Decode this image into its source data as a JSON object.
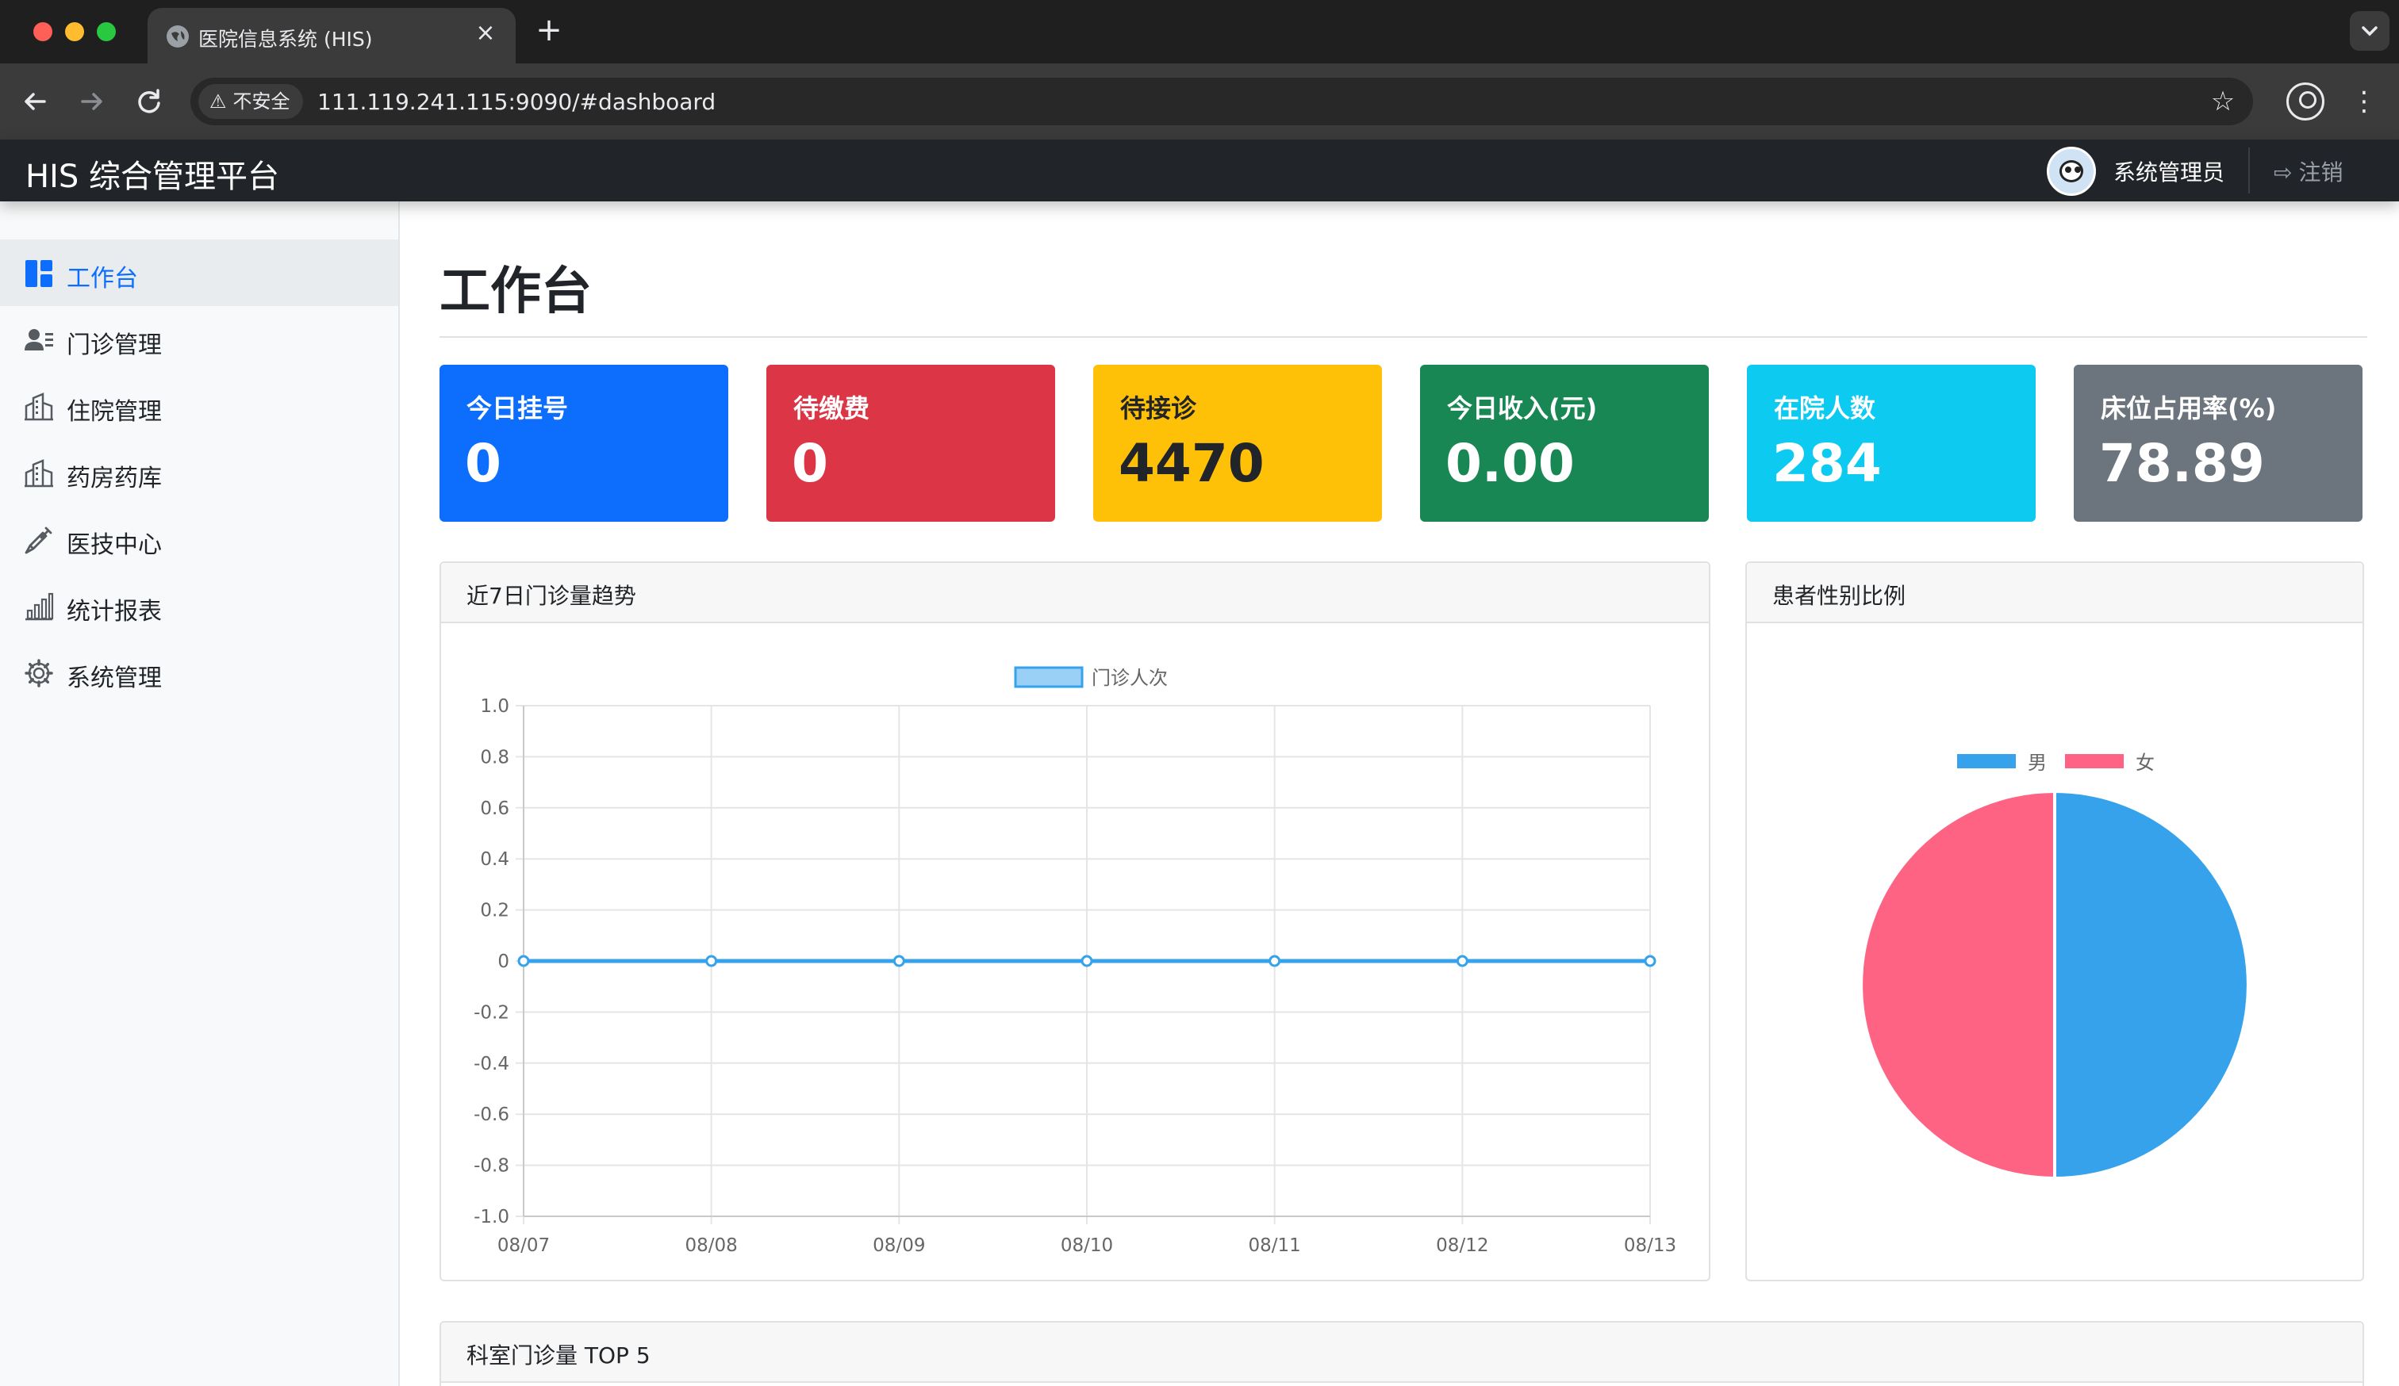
{
  "browser": {
    "tab_title": "医院信息系统 (HIS)",
    "tab_close": "×",
    "new_tab": "+",
    "tab_search_icon": "chevron-down-icon",
    "security_label": "不安全",
    "url": "111.119.241.115:9090/#dashboard"
  },
  "header": {
    "brand": "HIS 综合管理平台",
    "user_name": "系统管理员",
    "logout_label": "注销"
  },
  "sidebar": {
    "items": [
      {
        "label": "工作台",
        "icon": "dashboard-icon",
        "active": true
      },
      {
        "label": "门诊管理",
        "icon": "users-icon",
        "active": false
      },
      {
        "label": "住院管理",
        "icon": "building-icon",
        "active": false
      },
      {
        "label": "药房药库",
        "icon": "building-icon",
        "active": false
      },
      {
        "label": "医技中心",
        "icon": "syringe-icon",
        "active": false
      },
      {
        "label": "统计报表",
        "icon": "bar-chart-icon",
        "active": false
      },
      {
        "label": "系统管理",
        "icon": "gear-icon",
        "active": false
      }
    ]
  },
  "page": {
    "title": "工作台"
  },
  "stats": [
    {
      "label": "今日挂号",
      "value": "0",
      "bg": "#0d6efd",
      "fg": "#ffffff"
    },
    {
      "label": "待缴费",
      "value": "0",
      "bg": "#dc3545",
      "fg": "#ffffff"
    },
    {
      "label": "待接诊",
      "value": "4470",
      "bg": "#ffc107",
      "fg": "#212529"
    },
    {
      "label": "今日收入(元)",
      "value": "0.00",
      "bg": "#198754",
      "fg": "#ffffff"
    },
    {
      "label": "在院人数",
      "value": "284",
      "bg": "#0dcaf0",
      "fg": "#ffffff"
    },
    {
      "label": "床位占用率(%)",
      "value": "78.89",
      "bg": "#6c757d",
      "fg": "#ffffff"
    }
  ],
  "panels": {
    "trend_title": "近7日门诊量趋势",
    "gender_title": "患者性别比例",
    "top5_title": "科室门诊量 TOP 5"
  },
  "chart_data": [
    {
      "type": "line",
      "x": [
        "08/07",
        "08/08",
        "08/09",
        "08/10",
        "08/11",
        "08/12",
        "08/13"
      ],
      "series": [
        {
          "name": "门诊人次",
          "values": [
            0,
            0,
            0,
            0,
            0,
            0,
            0
          ],
          "color": "#36a2eb"
        }
      ],
      "ylim": [
        -1.0,
        1.0
      ],
      "yticks": [
        "1.0",
        "0.8",
        "0.6",
        "0.4",
        "0.2",
        "0",
        "-0.2",
        "-0.4",
        "-0.6",
        "-0.8",
        "-1.0"
      ],
      "grid": true,
      "legend": "top-center"
    },
    {
      "type": "pie",
      "categories": [
        "男",
        "女"
      ],
      "values": [
        50,
        50
      ],
      "colors": [
        "#36a2eb",
        "#ff6384"
      ],
      "legend": "top-center"
    }
  ]
}
